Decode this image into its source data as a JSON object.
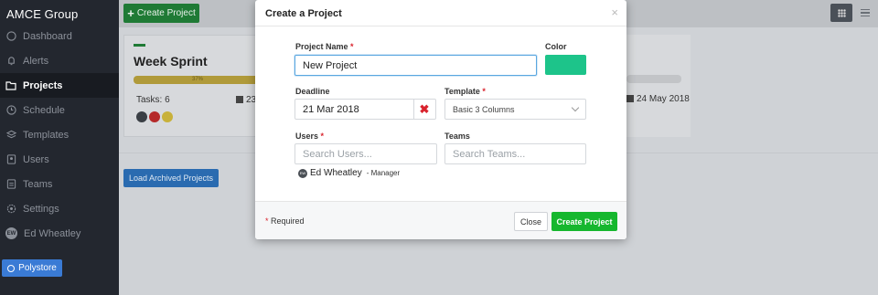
{
  "app": {
    "brand": "AMCE Group"
  },
  "sidebar": {
    "items": [
      {
        "label": "Dashboard",
        "icon": "dashboard-icon"
      },
      {
        "label": "Alerts",
        "icon": "bell-icon"
      },
      {
        "label": "Projects",
        "icon": "folder-icon",
        "active": true
      },
      {
        "label": "Schedule",
        "icon": "clock-icon"
      },
      {
        "label": "Templates",
        "icon": "layers-icon"
      },
      {
        "label": "Users",
        "icon": "user-icon"
      },
      {
        "label": "Teams",
        "icon": "team-icon"
      },
      {
        "label": "Settings",
        "icon": "gear-icon"
      },
      {
        "label": "Ed Wheatley",
        "icon": "avatar",
        "initials": "EW"
      }
    ],
    "polystore_label": "Polystore"
  },
  "toolbar": {
    "create_label": "Create Project"
  },
  "project_card": {
    "title": "Week Sprint",
    "progress_label": "37%",
    "progress": 0.37,
    "tasks_label": "Tasks: 6",
    "start_date": "23",
    "end_date": "24 May 2018"
  },
  "archive_label": "Load Archived Projects",
  "modal": {
    "title": "Create a Project",
    "close_icon": "×",
    "project_name_label": "Project Name",
    "project_name_value": "New Project",
    "color_label": "Color",
    "color_value": "#1dc48a",
    "deadline_label": "Deadline",
    "deadline_value": "21 Mar 2018",
    "template_label": "Template",
    "template_value": "Basic 3 Columns",
    "users_label": "Users",
    "users_placeholder": "Search Users...",
    "teams_label": "Teams",
    "teams_placeholder": "Search Teams...",
    "selected_user": {
      "initials": "EW",
      "name": "Ed Wheatley",
      "role": "- Manager"
    },
    "required_mark": "*",
    "required_note": "Required",
    "close_button": "Close",
    "create_button": "Create Project"
  }
}
